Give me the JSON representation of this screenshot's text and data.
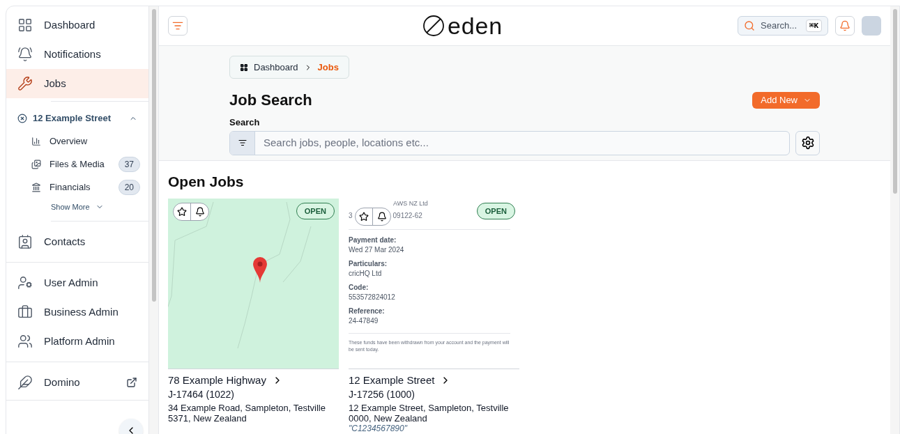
{
  "sidebar": {
    "items": [
      {
        "kind": "nav",
        "label": "Dashboard",
        "selected": false
      },
      {
        "kind": "nav",
        "label": "Notifications",
        "selected": false
      },
      {
        "kind": "nav",
        "label": "Jobs",
        "selected": true
      },
      {
        "kind": "group",
        "label": "12 Example Street",
        "expanded": true,
        "children": [
          {
            "label": "Overview"
          },
          {
            "label": "Files & Media",
            "count": "37"
          },
          {
            "label": "Financials",
            "count": "20"
          }
        ],
        "more": "Show More"
      },
      {
        "kind": "nav",
        "label": "Contacts",
        "selected": false
      },
      {
        "kind": "divider"
      },
      {
        "kind": "nav",
        "label": "User Admin",
        "selected": false
      },
      {
        "kind": "nav",
        "label": "Business Admin",
        "selected": false
      },
      {
        "kind": "nav",
        "label": "Platform Admin",
        "selected": false
      },
      {
        "kind": "divider"
      },
      {
        "kind": "external",
        "label": "Domino",
        "selected": false
      }
    ]
  },
  "header": {
    "logo": "eden",
    "search": {
      "placeholder": "Search...",
      "shortcut": "⌘K"
    }
  },
  "breadcrumb": [
    {
      "label": "Dashboard",
      "selected": false
    },
    {
      "label": "Jobs",
      "selected": true
    }
  ],
  "page_title": "Job Search",
  "add_button": "Add New",
  "search": {
    "label": "Search",
    "placeholder": "Search jobs, people, locations etc..."
  },
  "section_title": "Open Jobs",
  "jobs": [
    {
      "kind": "map",
      "status": "OPEN",
      "title": "78 Example Highway",
      "job_id": "J-17464 (1022)",
      "address": "34 Example Road, Sampleton, Testville 5371, New Zealand"
    },
    {
      "kind": "document",
      "status": "OPEN",
      "title": "12 Example Street",
      "job_id": "J-17256 (1000)",
      "address": "12 Example Street, Sampleton, Testville 0000, New Zealand",
      "reference": "\"C1234567890\"",
      "document": {
        "payer": "AWS NZ Ltd",
        "account_start": "3",
        "account_end": "09122-62",
        "fields": [
          {
            "label": "Payment date:",
            "value": "Wed 27 Mar 2024"
          },
          {
            "label": "Particulars:",
            "value": "cricHQ Ltd"
          },
          {
            "label": "Code:",
            "value": "553572824012"
          },
          {
            "label": "Reference:",
            "value": "24-47849"
          }
        ],
        "note": "These funds have been withdrawn from your account and the payment will be sent today."
      }
    }
  ]
}
